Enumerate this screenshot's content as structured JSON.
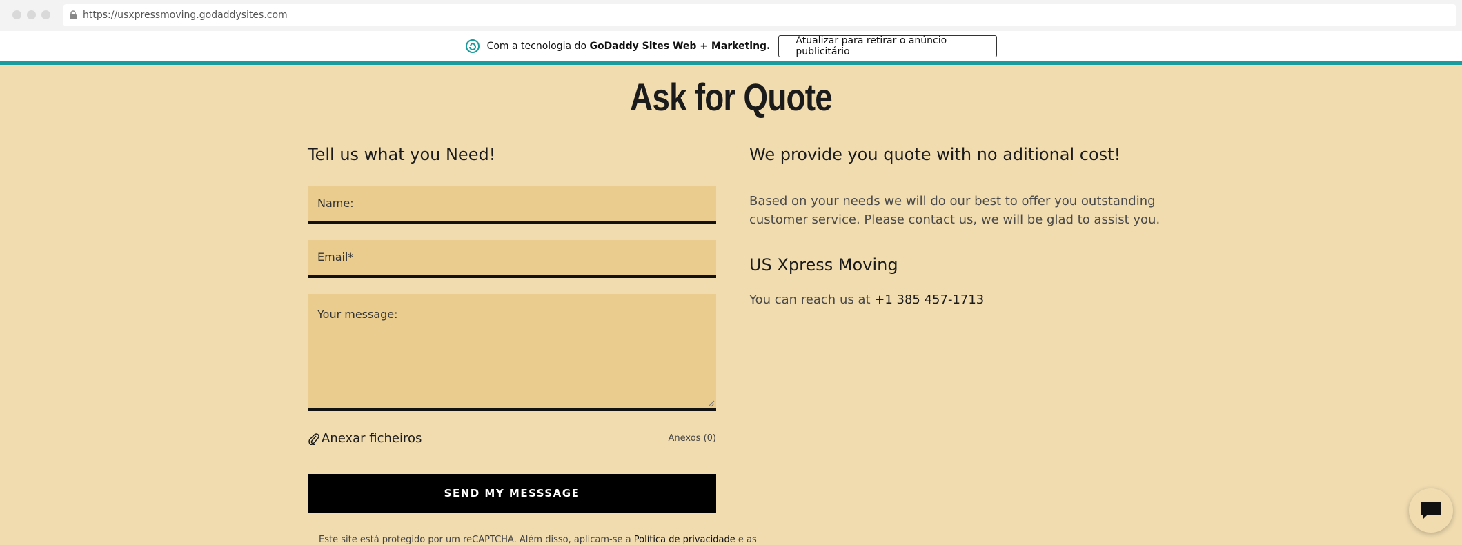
{
  "browser": {
    "url": "https://usxpressmoving.godaddysites.com"
  },
  "banner": {
    "prefix": "Com a tecnologia do ",
    "brand": "GoDaddy Sites Web + Marketing.",
    "upgrade_label": "Atualizar para retirar o anúncio publicitário"
  },
  "page": {
    "title": "Ask for Quote"
  },
  "form": {
    "heading": "Tell us what you Need!",
    "name_placeholder": "Name:",
    "email_placeholder": "Email*",
    "message_placeholder": "Your message:",
    "attach_label": "Anexar ficheiros",
    "attach_count": "Anexos (0)",
    "send_label": "SEND MY MESSSAGE",
    "recaptcha_prefix": "Este site está protegido por um reCAPTCHA. Além disso, aplicam-se a ",
    "privacy_link": "Política de privacidade",
    "recaptcha_suffix": " e as"
  },
  "info": {
    "heading": "We provide you quote with no aditional cost!",
    "description": "Based on your needs we will do our best to offer you outstanding customer service. Please contact us, we will be glad to assist you.",
    "company": "US Xpress Moving",
    "reach_prefix": "You can reach us at ",
    "phone": "+1 385 457-1713"
  },
  "colors": {
    "background": "#f1dcb0",
    "field": "#e9cc8e",
    "accent": "#1a9b9e",
    "button": "#000000"
  }
}
